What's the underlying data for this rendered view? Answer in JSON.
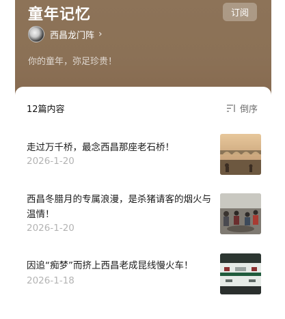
{
  "column": {
    "title": "童年记忆",
    "subscribe_label": "订阅",
    "author_name": "西昌龙门阵",
    "description": "你的童年，弥足珍贵！"
  },
  "list": {
    "count_label": "12篇内容",
    "sort_label": "倒序",
    "articles": [
      {
        "title": "走过万千桥，最念西昌那座老石桥！",
        "date": "2026-1-20",
        "thumb_icon": "stone-bridge-photo"
      },
      {
        "title": "西昌冬腊月的专属浪漫，是杀猪请客的烟火与温情！",
        "date": "2026-1-20",
        "thumb_icon": "village-feast-photo"
      },
      {
        "title": "因追“痴梦”而挤上西昌老成昆线慢火车！",
        "date": "2026-1-18",
        "thumb_icon": "green-train-photo"
      }
    ]
  },
  "colors": {
    "hero_brown": "#8b7156",
    "date_gray": "#b3b3b3"
  }
}
